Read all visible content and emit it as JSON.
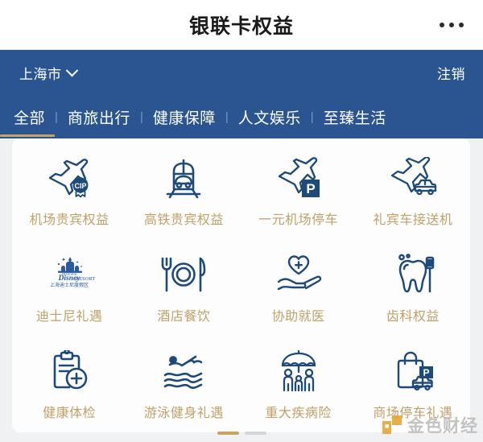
{
  "titlebar": {
    "title": "银联卡权益",
    "more_icon": "ellipsis-icon"
  },
  "header": {
    "city": "上海市",
    "city_chevron_icon": "chevron-down-icon",
    "logout": "注销",
    "accent_color": "#2a5590",
    "underline_color": "#c2a46a",
    "tabs": [
      {
        "label": "全部",
        "active": true
      },
      {
        "label": "商旅出行",
        "active": false
      },
      {
        "label": "健康保障",
        "active": false
      },
      {
        "label": "人文娱乐",
        "active": false
      },
      {
        "label": "至臻生活",
        "active": false
      }
    ],
    "tab_separator": "|"
  },
  "grid": {
    "label_color": "#bfa169",
    "icon_color": "#1e4a7a",
    "items": [
      {
        "label": "机场贵宾权益",
        "icon": "airplane-cip-badge-icon"
      },
      {
        "label": "高铁贵宾权益",
        "icon": "high-speed-train-icon"
      },
      {
        "label": "一元机场停车",
        "icon": "airplane-parking-icon"
      },
      {
        "label": "礼宾车接送机",
        "icon": "airplane-car-transfer-icon"
      },
      {
        "label": "迪士尼礼遇",
        "icon": "disney-resort-logo-icon"
      },
      {
        "label": "酒店餐饮",
        "icon": "fork-plate-knife-icon"
      },
      {
        "label": "协助就医",
        "icon": "hand-heart-medical-icon"
      },
      {
        "label": "齿科权益",
        "icon": "tooth-toothbrush-icon"
      },
      {
        "label": "健康体检",
        "icon": "clipboard-medical-icon"
      },
      {
        "label": "游泳健身礼遇",
        "icon": "swimmer-icon"
      },
      {
        "label": "重大疾病险",
        "icon": "umbrella-family-icon"
      },
      {
        "label": "商场停车礼遇",
        "icon": "shopping-bag-car-parking-icon"
      }
    ]
  },
  "pager": {
    "dots": [
      {
        "active": true
      },
      {
        "active": false
      }
    ]
  },
  "watermark": {
    "text": "金色财经",
    "mark_color": "#e8a028"
  }
}
